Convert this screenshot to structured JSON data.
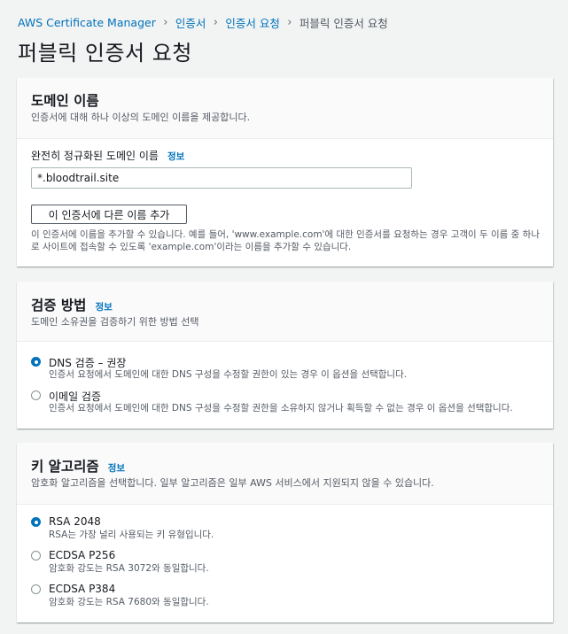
{
  "breadcrumb": {
    "items": [
      "AWS Certificate Manager",
      "인증서",
      "인증서 요청",
      "퍼블릭 인증서 요청"
    ]
  },
  "page_title": "퍼블릭 인증서 요청",
  "domain_section": {
    "title": "도메인 이름",
    "description": "인증서에 대해 하나 이상의 도메인 이름을 제공합니다.",
    "field_label": "완전히 정규화된 도메인 이름",
    "info_label": "정보",
    "input_value": "*.bloodtrail.site",
    "add_button_label": "이 인증서에 다른 이름 추가",
    "help_text": "이 인증서에 이름을 추가할 수 있습니다. 예를 들어, 'www.example.com'에 대한 인증서를 요청하는 경우 고객이 두 이름 중 하나로 사이트에 접속할 수 있도록 'example.com'이라는 이름을 추가할 수 있습니다."
  },
  "validation_section": {
    "title": "검증 방법",
    "info_label": "정보",
    "description": "도메인 소유권을 검증하기 위한 방법 선택",
    "options": [
      {
        "label": "DNS 검증 – 권장",
        "description": "인증서 요청에서 도메인에 대한 DNS 구성을 수정할 권한이 있는 경우 이 옵션을 선택합니다.",
        "selected": true
      },
      {
        "label": "이메일 검증",
        "description": "인증서 요청에서 도메인에 대한 DNS 구성을 수정할 권한을 소유하지 않거나 획득할 수 없는 경우 이 옵션을 선택합니다.",
        "selected": false
      }
    ]
  },
  "key_section": {
    "title": "키 알고리즘",
    "info_label": "정보",
    "description": "암호화 알고리즘을 선택합니다. 일부 알고리즘은 일부 AWS 서비스에서 지원되지 않을 수 있습니다.",
    "options": [
      {
        "label": "RSA 2048",
        "description": "RSA는 가장 널리 사용되는 키 유형입니다.",
        "selected": true
      },
      {
        "label": "ECDSA P256",
        "description": "암호화 강도는 RSA 3072와 동일합니다.",
        "selected": false
      },
      {
        "label": "ECDSA P384",
        "description": "암호화 강도는 RSA 7680와 동일합니다.",
        "selected": false
      }
    ]
  },
  "icons": {
    "breadcrumb_separator": "chevron-right-icon"
  },
  "colors": {
    "link": "#0073bb",
    "background": "#f2f3f3",
    "text": "#16191f",
    "secondary_text": "#545b64"
  }
}
